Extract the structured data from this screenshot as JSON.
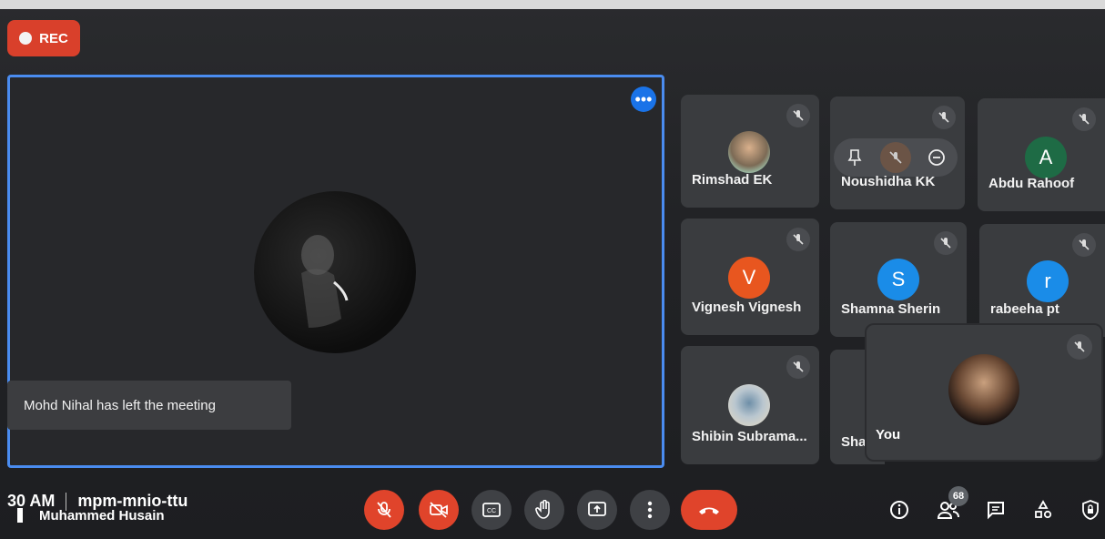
{
  "recording": {
    "label": "REC"
  },
  "main": {
    "speaker_name": "Muhammed Husain",
    "toast": "Mohd Nihal has left the meeting"
  },
  "participants": [
    {
      "name": "Rimshad EK",
      "avatar_type": "photo"
    },
    {
      "name": "Noushidha KK",
      "avatar_type": "hover-controls"
    },
    {
      "name": "Abdu Rahoof",
      "avatar_letter": "A",
      "color": "#1e6b45"
    },
    {
      "name": "Vignesh Vignesh",
      "avatar_letter": "V",
      "color": "#e8561f"
    },
    {
      "name": "Shamna Sherin",
      "avatar_letter": "S",
      "color": "#1a8ce8"
    },
    {
      "name": "rabeeha pt",
      "avatar_letter": "r",
      "color": "#1a8ce8"
    },
    {
      "name": "Shibin Subrama...",
      "avatar_type": "photo"
    },
    {
      "name": "Sha",
      "avatar_type": "partial"
    }
  ],
  "self": {
    "name": "You"
  },
  "bottom": {
    "time": "30 AM",
    "meeting_code": "mpm-mnio-ttu",
    "people_count": "68"
  },
  "colors": {
    "accent": "#4a8cf0",
    "danger": "#e0442b",
    "tile": "#3a3c3f"
  }
}
